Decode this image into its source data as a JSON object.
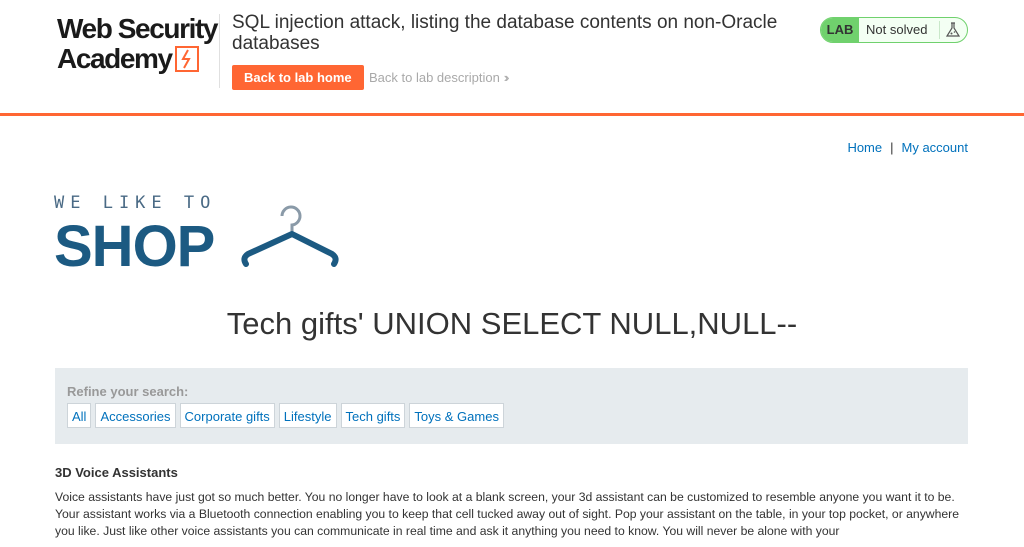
{
  "academy": {
    "logo_line1": "Web Security",
    "logo_line2": "Academy",
    "lab_title": "SQL injection attack, listing the database contents on non-Oracle databases",
    "back_home_label": "Back to lab home",
    "back_description_label": "Back to lab description",
    "status_badge": "LAB",
    "status_text": "Not solved"
  },
  "nav": {
    "home_label": "Home",
    "separator": "|",
    "account_label": "My account"
  },
  "shop_logo": {
    "small_text": "WE LIKE TO",
    "big_text": "SHOP"
  },
  "page_heading": "Tech gifts' UNION SELECT NULL,NULL--",
  "filters": {
    "label": "Refine your search:",
    "items": [
      "All",
      "Accessories",
      "Corporate gifts",
      "Lifestyle",
      "Tech gifts",
      "Toys & Games"
    ]
  },
  "results": [
    {
      "title": "3D Voice Assistants",
      "description": "Voice assistants have just got so much better. You no longer have to look at a blank screen, your 3d assistant can be customized to resemble anyone you want it to be. Your assistant works via a Bluetooth connection enabling you to keep that cell tucked away out of sight. Pop your assistant on the table, in your top pocket, or anywhere you like. Just like other voice assistants you can communicate in real time and ask it anything you need to know. You will never be alone with your"
    }
  ],
  "colors": {
    "brand_orange": "#ff6633",
    "lab_green": "#70d16d",
    "link_blue": "#0071bc",
    "shop_blue": "#1c5a82",
    "filter_bg": "#e6ebee"
  },
  "icons": [
    "bolt-icon",
    "flask-icon",
    "chevron-right-icon",
    "hanger-icon"
  ]
}
